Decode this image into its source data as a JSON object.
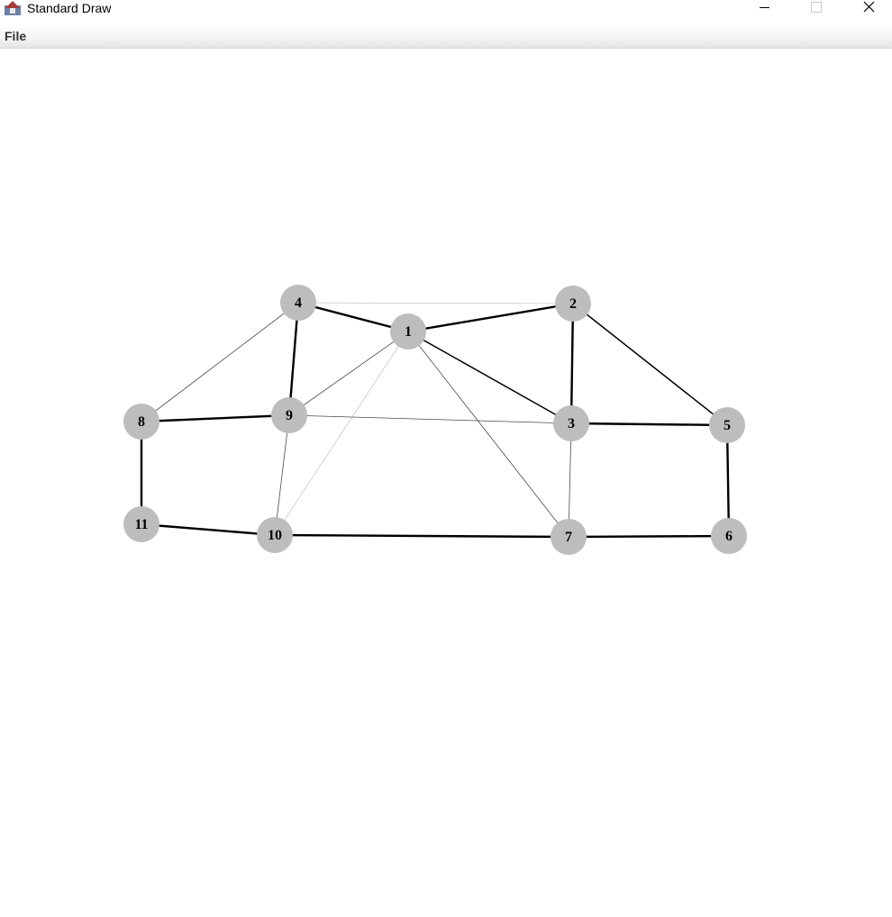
{
  "window": {
    "title": "Standard Draw",
    "controls": [
      "minimize-icon",
      "maximize-icon",
      "close-icon"
    ]
  },
  "menubar": {
    "items": [
      {
        "label": "File"
      }
    ]
  },
  "graph": {
    "node_fill": "#bdbdbd",
    "edge_color": "#000000",
    "nodes": [
      {
        "id": "1",
        "label": "1"
      },
      {
        "id": "2",
        "label": "2"
      },
      {
        "id": "3",
        "label": "3"
      },
      {
        "id": "4",
        "label": "4"
      },
      {
        "id": "5",
        "label": "5"
      },
      {
        "id": "6",
        "label": "6"
      },
      {
        "id": "7",
        "label": "7"
      },
      {
        "id": "8",
        "label": "8"
      },
      {
        "id": "9",
        "label": "9"
      },
      {
        "id": "10",
        "label": "10"
      },
      {
        "id": "11",
        "label": "11"
      }
    ],
    "edges": [
      {
        "from": "4",
        "to": "1",
        "weight": "heavy"
      },
      {
        "from": "1",
        "to": "2",
        "weight": "heavy"
      },
      {
        "from": "4",
        "to": "2",
        "weight": "faint"
      },
      {
        "from": "2",
        "to": "3",
        "weight": "heavy"
      },
      {
        "from": "2",
        "to": "5",
        "weight": "medium"
      },
      {
        "from": "1",
        "to": "3",
        "weight": "medium"
      },
      {
        "from": "1",
        "to": "9",
        "weight": "thin"
      },
      {
        "from": "1",
        "to": "10",
        "weight": "faint"
      },
      {
        "from": "1",
        "to": "7",
        "weight": "thin"
      },
      {
        "from": "4",
        "to": "9",
        "weight": "heavy"
      },
      {
        "from": "4",
        "to": "8",
        "weight": "thin"
      },
      {
        "from": "8",
        "to": "9",
        "weight": "heavy"
      },
      {
        "from": "9",
        "to": "3",
        "weight": "thin"
      },
      {
        "from": "9",
        "to": "10",
        "weight": "thin"
      },
      {
        "from": "3",
        "to": "5",
        "weight": "heavy"
      },
      {
        "from": "3",
        "to": "7",
        "weight": "thin"
      },
      {
        "from": "5",
        "to": "6",
        "weight": "heavy"
      },
      {
        "from": "8",
        "to": "11",
        "weight": "heavy"
      },
      {
        "from": "11",
        "to": "10",
        "weight": "heavy"
      },
      {
        "from": "10",
        "to": "7",
        "weight": "heavy"
      },
      {
        "from": "7",
        "to": "6",
        "weight": "heavy"
      }
    ]
  }
}
